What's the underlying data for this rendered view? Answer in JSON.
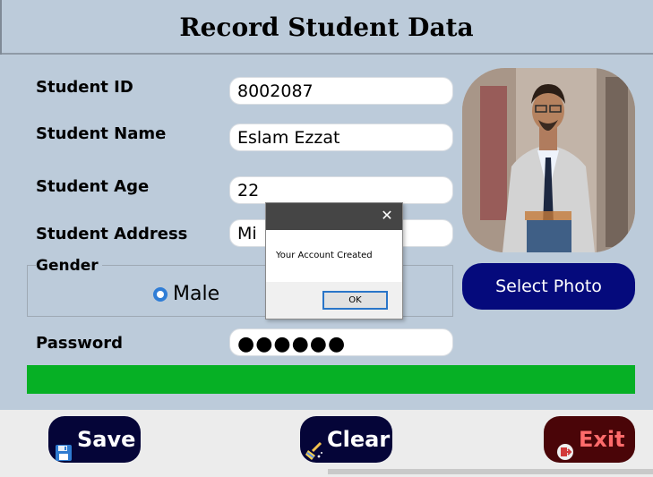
{
  "form": {
    "title": "Record Student Data",
    "labels": {
      "student_id": "Student ID",
      "student_name": "Student Name",
      "student_age": "Student Age",
      "student_address": "Student Address",
      "gender": "Gender",
      "password": "Password"
    },
    "values": {
      "student_id": "8002087",
      "student_name": "Eslam Ezzat",
      "student_age": "22",
      "student_address": "Mi",
      "password": "●●●●●●"
    },
    "gender_options": {
      "male": "Male"
    },
    "progress": 1.0,
    "progress_color": "#06b025"
  },
  "buttons": {
    "select_photo": "Select Photo",
    "save": "Save",
    "clear": "Clear",
    "exit": "Exit"
  },
  "dialog": {
    "message": "Your Account Created",
    "ok_label": "OK"
  },
  "icons": {
    "save": "floppy-disk-icon",
    "clear": "broom-icon",
    "exit": "exit-icon",
    "close": "close-icon"
  }
}
